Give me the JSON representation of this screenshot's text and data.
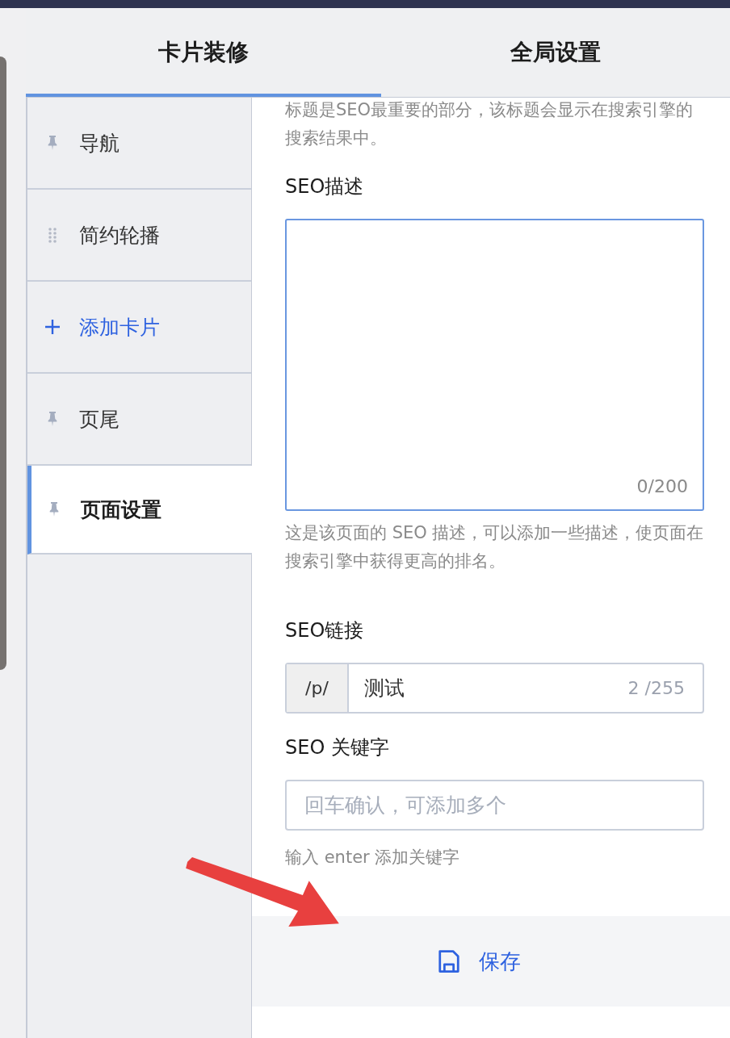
{
  "tabs": [
    {
      "label": "卡片装修",
      "selected": true
    },
    {
      "label": "全局设置",
      "selected": false
    }
  ],
  "sidebar": {
    "items": [
      {
        "label": "导航",
        "kind": "pin",
        "selected": false
      },
      {
        "label": "简约轮播",
        "kind": "drag",
        "selected": false
      },
      {
        "label": "添加卡片",
        "kind": "add",
        "selected": false
      },
      {
        "label": "页尾",
        "kind": "pin",
        "selected": false
      },
      {
        "label": "页面设置",
        "kind": "pin",
        "selected": true
      }
    ]
  },
  "form": {
    "title_help": "标题是SEO最重要的部分，该标题会显示在搜索引擎的搜索结果中。",
    "description": {
      "label": "SEO描述",
      "focused": true,
      "counter": "0/200",
      "help": "这是该页面的 SEO 描述，可以添加一些描述，使页面在搜索引擎中获得更高的排名。"
    },
    "link": {
      "label": "SEO链接",
      "prefix": "/p/",
      "value": "测试",
      "counter": "2 /255"
    },
    "keywords": {
      "label": "SEO 关键字",
      "placeholder": "回车确认，可添加多个",
      "help": "输入 enter 添加关键字"
    }
  },
  "save_button": {
    "label": "保存"
  }
}
